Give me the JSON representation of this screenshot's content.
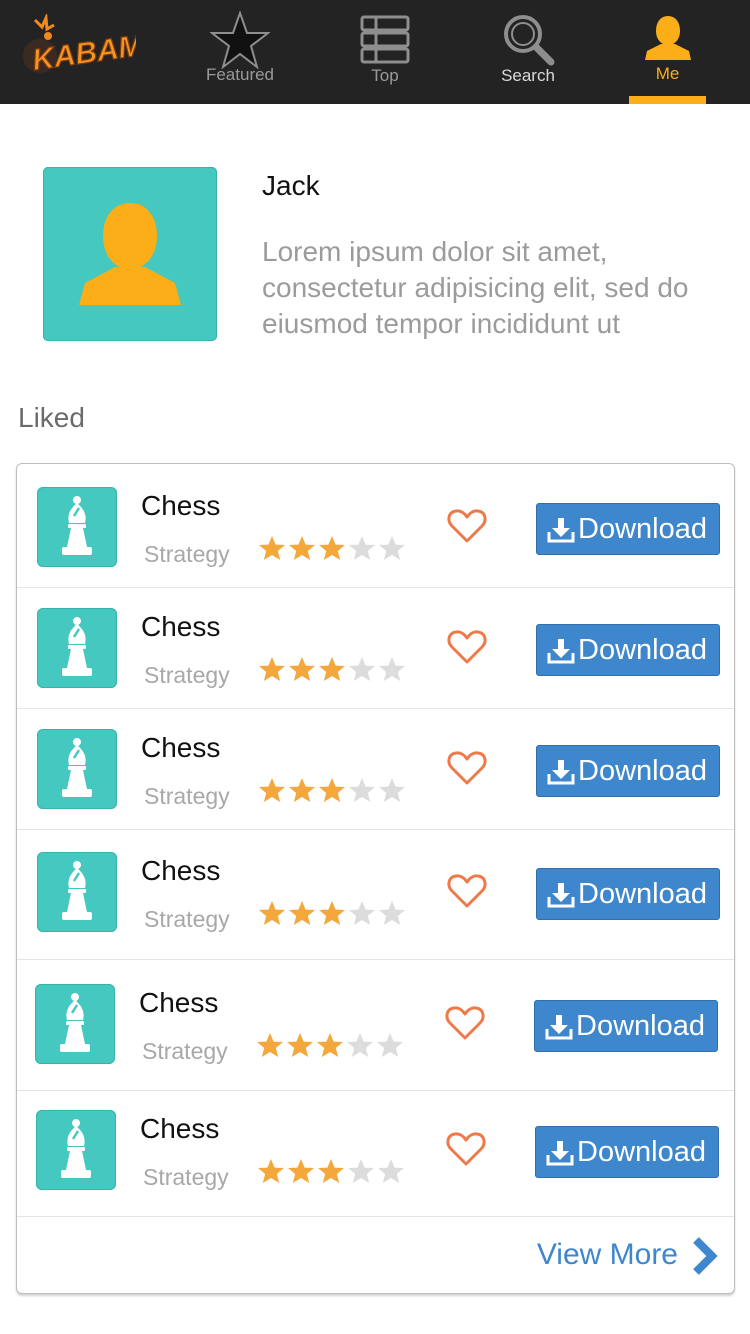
{
  "nav": {
    "logo_text": "KABAM",
    "items": [
      {
        "label": "Featured",
        "icon": "star-icon"
      },
      {
        "label": "Top",
        "icon": "list-icon"
      },
      {
        "label": "Search",
        "icon": "search-icon"
      },
      {
        "label": "Me",
        "icon": "user-icon",
        "active": true
      }
    ]
  },
  "profile": {
    "name": "Jack",
    "bio": "Lorem ipsum dolor sit amet, consectetur adipisicing elit, sed do eiusmod tempor incididunt ut"
  },
  "liked": {
    "title": "Liked",
    "apps": [
      {
        "name": "Chess",
        "category": "Strategy",
        "rating": 3,
        "max_rating": 5,
        "button": "Download"
      },
      {
        "name": "Chess",
        "category": "Strategy",
        "rating": 3,
        "max_rating": 5,
        "button": "Download"
      },
      {
        "name": "Chess",
        "category": "Strategy",
        "rating": 3,
        "max_rating": 5,
        "button": "Download"
      },
      {
        "name": "Chess",
        "category": "Strategy",
        "rating": 3,
        "max_rating": 5,
        "button": "Download"
      },
      {
        "name": "Chess",
        "category": "Strategy",
        "rating": 3,
        "max_rating": 5,
        "button": "Download"
      },
      {
        "name": "Chess",
        "category": "Strategy",
        "rating": 3,
        "max_rating": 5,
        "button": "Download"
      }
    ],
    "view_more": "View More"
  },
  "colors": {
    "nav_bg": "#232323",
    "accent_orange": "#fbae17",
    "teal": "#44c8bf",
    "star_on": "#f4a73b",
    "star_off": "#dcdcdc",
    "heart": "#ee7a4a",
    "button_blue": "#3e87cc"
  }
}
